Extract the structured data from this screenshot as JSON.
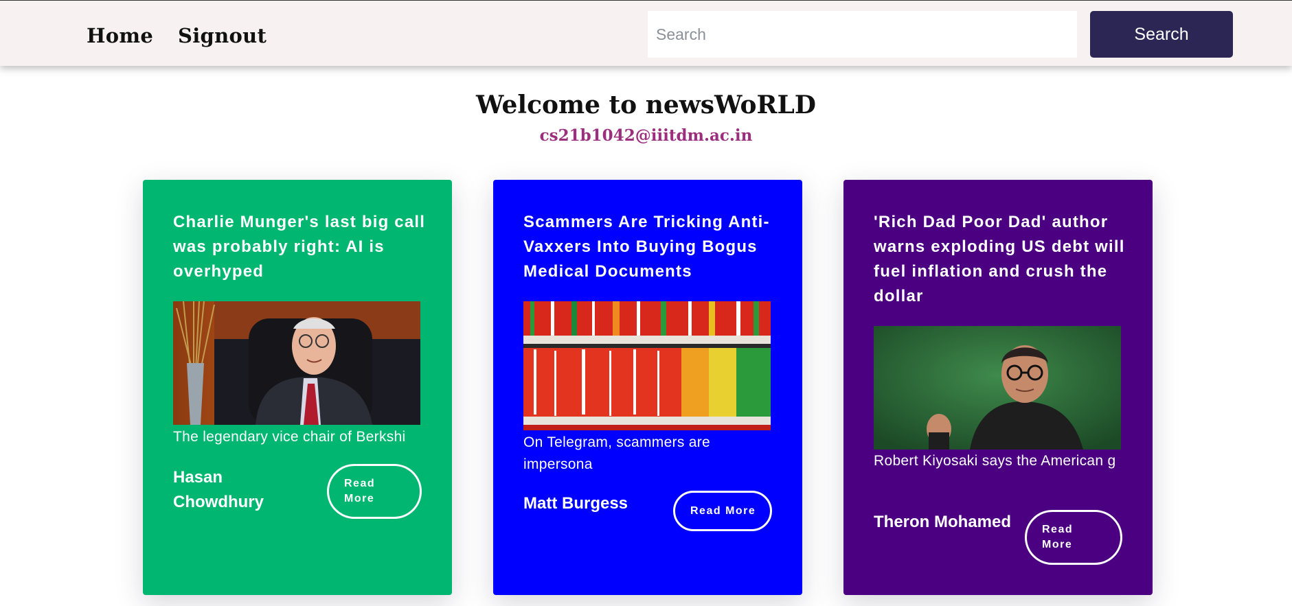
{
  "nav": {
    "home": "Home",
    "signout": "Signout",
    "search_placeholder": "Search",
    "search_button": "Search"
  },
  "header": {
    "welcome": "Welcome to newsWoRLD",
    "email": "cs21b1042@iiitdm.ac.in"
  },
  "colors": {
    "navbar_bg": "#f7f1f1",
    "search_button_bg": "#2c2654",
    "email": "#9b2f7e",
    "card1": "#00b670",
    "card2": "#0000ff",
    "card3": "#4b0082"
  },
  "cards": [
    {
      "title": "Charlie Munger's last big call was probably right: AI is overhyped",
      "image_alt": "Charlie Munger seated in a leather chair",
      "description": "The legendary vice chair of Berkshi",
      "author": "Hasan Chowdhury",
      "button": "Read More"
    },
    {
      "title": "Scammers Are Tricking Anti-Vaxxers Into Buying Bogus Medical Documents",
      "image_alt": "Shelves of color-coded medical file folders",
      "description": "On Telegram, scammers are impersona",
      "author": "Matt Burgess",
      "button": "Read More"
    },
    {
      "title": "'Rich Dad Poor Dad' author warns exploding US debt will fuel inflation and crush the dollar",
      "image_alt": "Robert Kiyosaki speaking",
      "description": "Robert Kiyosaki says the American g",
      "author": "Theron Mohamed",
      "button": "Read More"
    }
  ]
}
